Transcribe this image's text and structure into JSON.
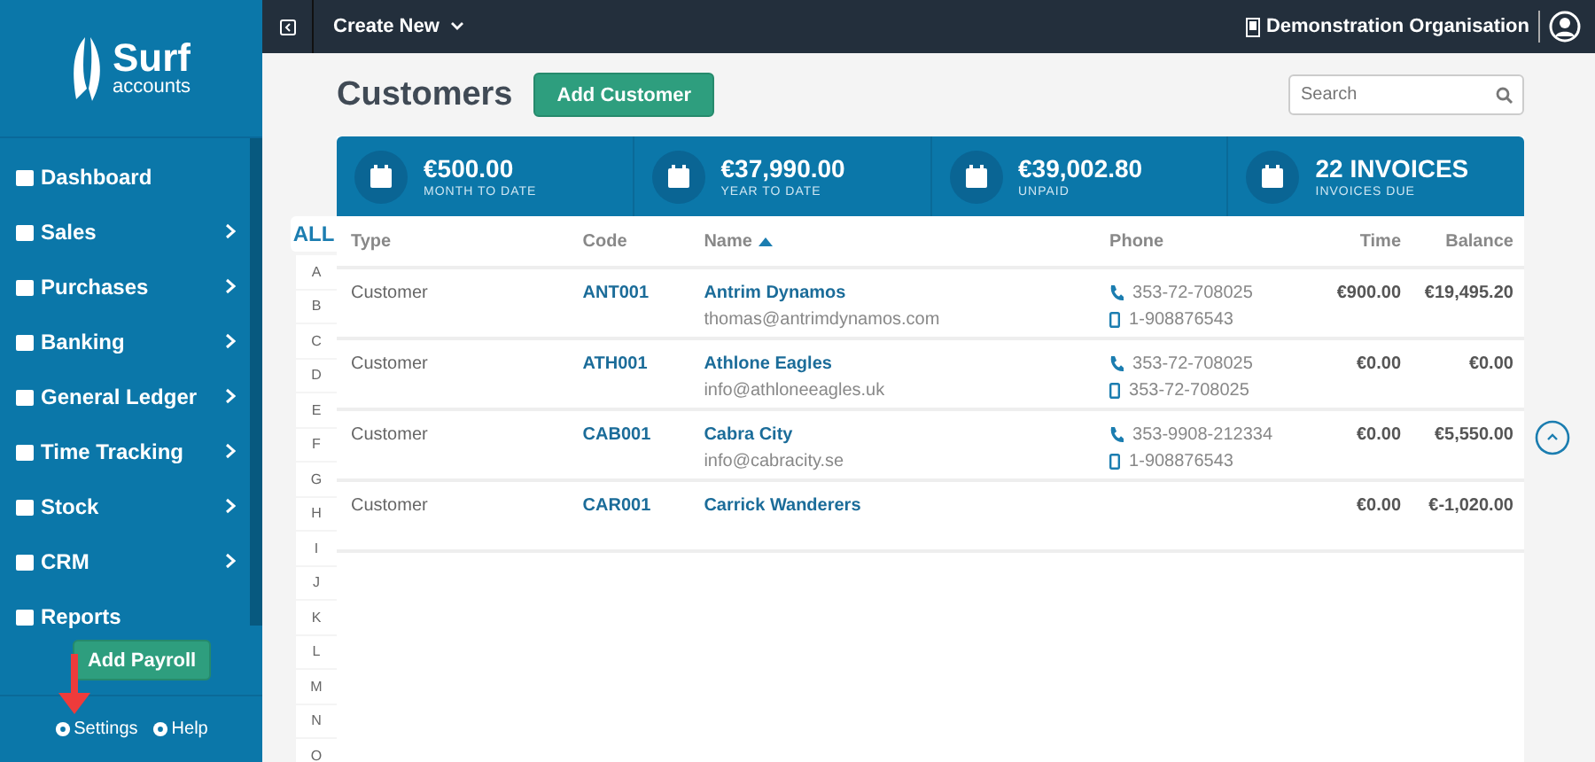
{
  "logo": {
    "name": "Surf",
    "tagline": "accounts"
  },
  "sidebar": {
    "items": [
      {
        "label": "Dashboard",
        "expandable": false
      },
      {
        "label": "Sales",
        "expandable": true
      },
      {
        "label": "Purchases",
        "expandable": true
      },
      {
        "label": "Banking",
        "expandable": true
      },
      {
        "label": "General Ledger",
        "expandable": true
      },
      {
        "label": "Time Tracking",
        "expandable": true
      },
      {
        "label": "Stock",
        "expandable": true
      },
      {
        "label": "CRM",
        "expandable": true
      },
      {
        "label": "Reports",
        "expandable": false
      }
    ],
    "button": "Add Payroll",
    "footer_links": [
      "Settings",
      "Help"
    ]
  },
  "topbar": {
    "menu": "Create New",
    "organisation": "Demonstration Organisation"
  },
  "page": {
    "title": "Customers",
    "add_button": "Add Customer",
    "search": {
      "placeholder": "Search"
    }
  },
  "stats": [
    {
      "value": "€500.00",
      "label": "MONTH TO DATE"
    },
    {
      "value": "€37,990.00",
      "label": "YEAR TO DATE"
    },
    {
      "value": "€39,002.80",
      "label": "UNPAID"
    },
    {
      "value": "22 INVOICES",
      "label": "INVOICES DUE"
    }
  ],
  "alphabet": [
    {
      "label": "ALL",
      "selected": true
    },
    {
      "label": "A",
      "selected": false
    },
    {
      "label": "B",
      "selected": false
    },
    {
      "label": "C",
      "selected": false
    },
    {
      "label": "D",
      "selected": false
    },
    {
      "label": "E",
      "selected": false
    },
    {
      "label": "F",
      "selected": false
    },
    {
      "label": "G",
      "selected": false
    },
    {
      "label": "H",
      "selected": false
    },
    {
      "label": "I",
      "selected": false
    },
    {
      "label": "J",
      "selected": false
    },
    {
      "label": "K",
      "selected": false
    },
    {
      "label": "L",
      "selected": false
    },
    {
      "label": "M",
      "selected": false
    },
    {
      "label": "N",
      "selected": false
    },
    {
      "label": "O",
      "selected": false
    }
  ],
  "table": {
    "columns": [
      {
        "label": "Type",
        "sorted": false
      },
      {
        "label": "Code",
        "sorted": false
      },
      {
        "label": "Name",
        "sorted": true
      },
      {
        "label": "Phone",
        "sorted": false
      },
      {
        "label": "Time",
        "sorted": false
      },
      {
        "label": "Balance",
        "sorted": false
      }
    ],
    "rows": [
      {
        "type": "Customer",
        "code": "ANT001",
        "name": "Antrim Dynamos",
        "email": "thomas@antrimdynamos.com",
        "phone": "353-72-708025",
        "mobile": "1-908876543",
        "time": "€900.00",
        "balance": "€19,495.20"
      },
      {
        "type": "Customer",
        "code": "ATH001",
        "name": "Athlone Eagles",
        "email": "info@athloneeagles.uk",
        "phone": "353-72-708025",
        "mobile": "353-72-708025",
        "time": "€0.00",
        "balance": "€0.00"
      },
      {
        "type": "Customer",
        "code": "CAB001",
        "name": "Cabra City",
        "email": "info@cabracity.se",
        "phone": "353-9908-212334",
        "mobile": "1-908876543",
        "time": "€0.00",
        "balance": "€5,550.00"
      },
      {
        "type": "Customer",
        "code": "CAR001",
        "name": "Carrick Wanderers",
        "time": "€0.00",
        "balance": "€-1,020.00"
      }
    ]
  }
}
